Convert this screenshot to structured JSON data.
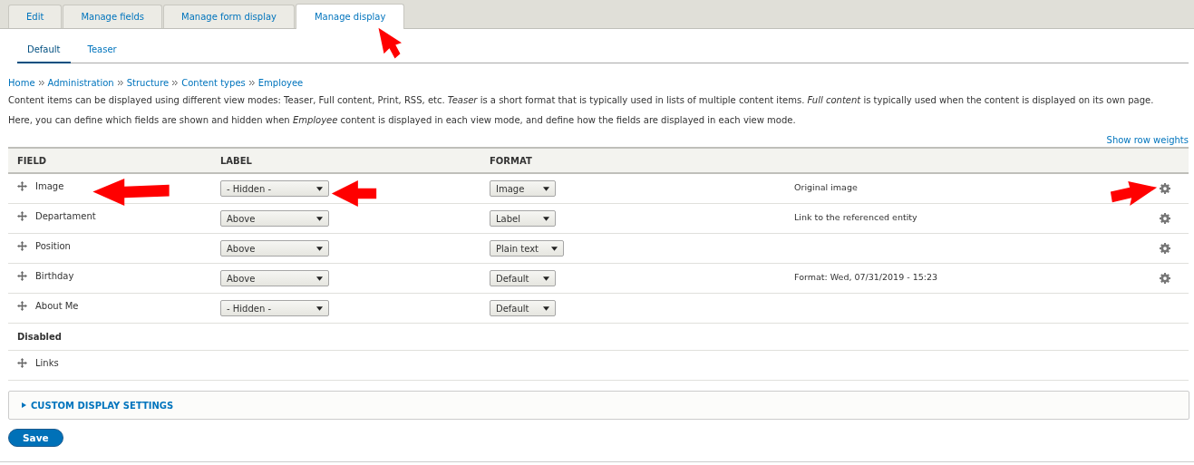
{
  "tabs": [
    {
      "label": "Edit",
      "selected": false
    },
    {
      "label": "Manage fields",
      "selected": false
    },
    {
      "label": "Manage form display",
      "selected": false
    },
    {
      "label": "Manage display",
      "selected": true
    }
  ],
  "subtabs": [
    {
      "label": "Default",
      "selected": true
    },
    {
      "label": "Teaser",
      "selected": false
    }
  ],
  "breadcrumb": [
    "Home",
    "Administration",
    "Structure",
    "Content types",
    "Employee"
  ],
  "intro": [
    "Content items can be displayed using different view modes: Teaser, Full content, Print, RSS, etc. *Teaser* is a short format that is typically used in lists of multiple content items. *Full content* is typically used when the content is displayed on its own page.",
    "Here, you can define which fields are shown and hidden when *Employee* content is displayed in each view mode, and define how the fields are displayed in each view mode."
  ],
  "show_row_weights": "Show row weights",
  "table": {
    "columns": [
      "FIELD",
      "LABEL",
      "FORMAT"
    ],
    "rows": [
      {
        "field": "Image",
        "label": "- Hidden -",
        "format": "Image",
        "summary": "Original image",
        "settings": true
      },
      {
        "field": "Departament",
        "label": "Above",
        "format": "Label",
        "summary": "Link to the referenced entity",
        "settings": true
      },
      {
        "field": "Position",
        "label": "Above",
        "format": "Plain text",
        "settings": true
      },
      {
        "field": "Birthday",
        "label": "Above",
        "format": "Default",
        "summary": "Format: Wed, 07/31/2019 - 15:23",
        "settings": true
      },
      {
        "field": "About Me",
        "label": "- Hidden -",
        "format": "Default",
        "settings": false
      }
    ],
    "disabled_heading": "Disabled",
    "disabled_rows": [
      {
        "field": "Links"
      }
    ]
  },
  "details": {
    "summary": "CUSTOM DISPLAY SETTINGS",
    "expanded": false
  },
  "save_button": "Save"
}
